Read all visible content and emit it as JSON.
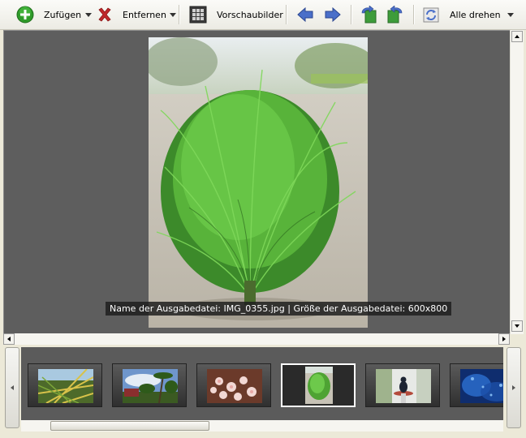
{
  "toolbar": {
    "add_label": "Zufügen",
    "remove_label": "Entfernen",
    "thumbnails_label": "Vorschaubilder",
    "rotate_all_label": "Alle drehen"
  },
  "viewer": {
    "caption": "Name der Ausgabedatei: IMG_0355.jpg | Größe der Ausgabedatei: 600x800"
  },
  "thumbnails": [
    {
      "icon": "palm-leaf-thumbnail"
    },
    {
      "icon": "palm-trees-sky-thumbnail"
    },
    {
      "icon": "pink-flowers-thumbnail"
    },
    {
      "icon": "green-plant-thumbnail",
      "selected": true
    },
    {
      "icon": "bird-thumbnail"
    },
    {
      "icon": "blue-water-thumbnail"
    }
  ],
  "colors": {
    "viewer_bg": "#5e5e5e",
    "toolbar_bg": "#f4f3ee",
    "add_green": "#2f9a2a",
    "remove_red": "#c0282b",
    "arrow_blue": "#3d5fb8"
  }
}
